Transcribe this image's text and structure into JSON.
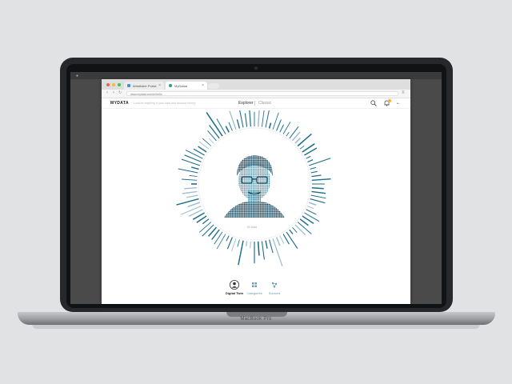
{
  "device": {
    "brand_label": "MacBook Pro"
  },
  "browser": {
    "tabs": [
      {
        "label": "#Mathaler Portal",
        "active": false,
        "color": "#4a90d9"
      },
      {
        "label": "MyDataa",
        "active": true,
        "color": "#2a9d8f"
      }
    ],
    "url": "www.mydata.com/m/hello"
  },
  "app": {
    "logo": "MYDATA",
    "search_placeholder": "Look for anything in your data and account history",
    "nav": {
      "explorer": "Explorer",
      "classic": "Classic"
    },
    "notification_color": "#f5b72b"
  },
  "twin": {
    "caption": "All Data",
    "accent_color": "#1e6e8c",
    "bars_count": 96
  },
  "bottom_nav": [
    {
      "label": "Digital Twin",
      "icon": "person-icon",
      "active": true
    },
    {
      "label": "Categories",
      "icon": "grid-icon",
      "active": false
    },
    {
      "label": "Sources",
      "icon": "network-icon",
      "active": false
    }
  ]
}
